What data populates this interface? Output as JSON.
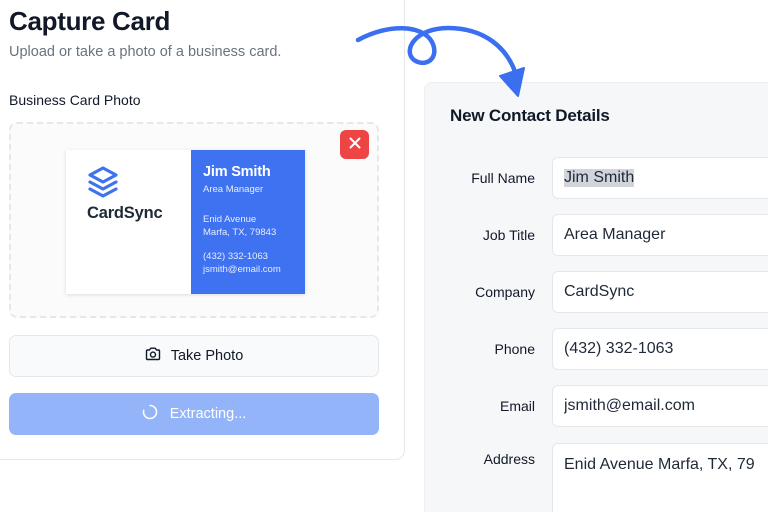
{
  "capture": {
    "title": "Capture Card",
    "subtitle": "Upload or take a photo of a business card.",
    "photo_label": "Business Card Photo",
    "take_photo_label": "Take Photo",
    "extract_label": "Extracting...",
    "take_photo_icon": "camera-icon",
    "extract_icon": "spinner-icon",
    "remove_icon": "close-icon"
  },
  "business_card": {
    "logo_icon": "layers-icon",
    "brand": "CardSync",
    "name": "Jim Smith",
    "title": "Area Manager",
    "address_line1": "Enid Avenue",
    "address_line2": "Marfa, TX, 79843",
    "phone": "(432) 332-1063",
    "email": "jsmith@email.com"
  },
  "contact_details": {
    "title": "New Contact Details",
    "fields": [
      {
        "label": "Full Name",
        "value": "Jim Smith"
      },
      {
        "label": "Job Title",
        "value": "Area Manager"
      },
      {
        "label": "Company",
        "value": "CardSync"
      },
      {
        "label": "Phone",
        "value": "(432) 332-1063"
      },
      {
        "label": "Email",
        "value": "jsmith@email.com"
      },
      {
        "label": "Address",
        "value": "Enid Avenue Marfa, TX, 79"
      }
    ]
  },
  "colors": {
    "accent": "#3f72f0",
    "accent_disabled": "#93b4f8",
    "danger": "#ef4444",
    "arrow": "#3b6ff0"
  }
}
